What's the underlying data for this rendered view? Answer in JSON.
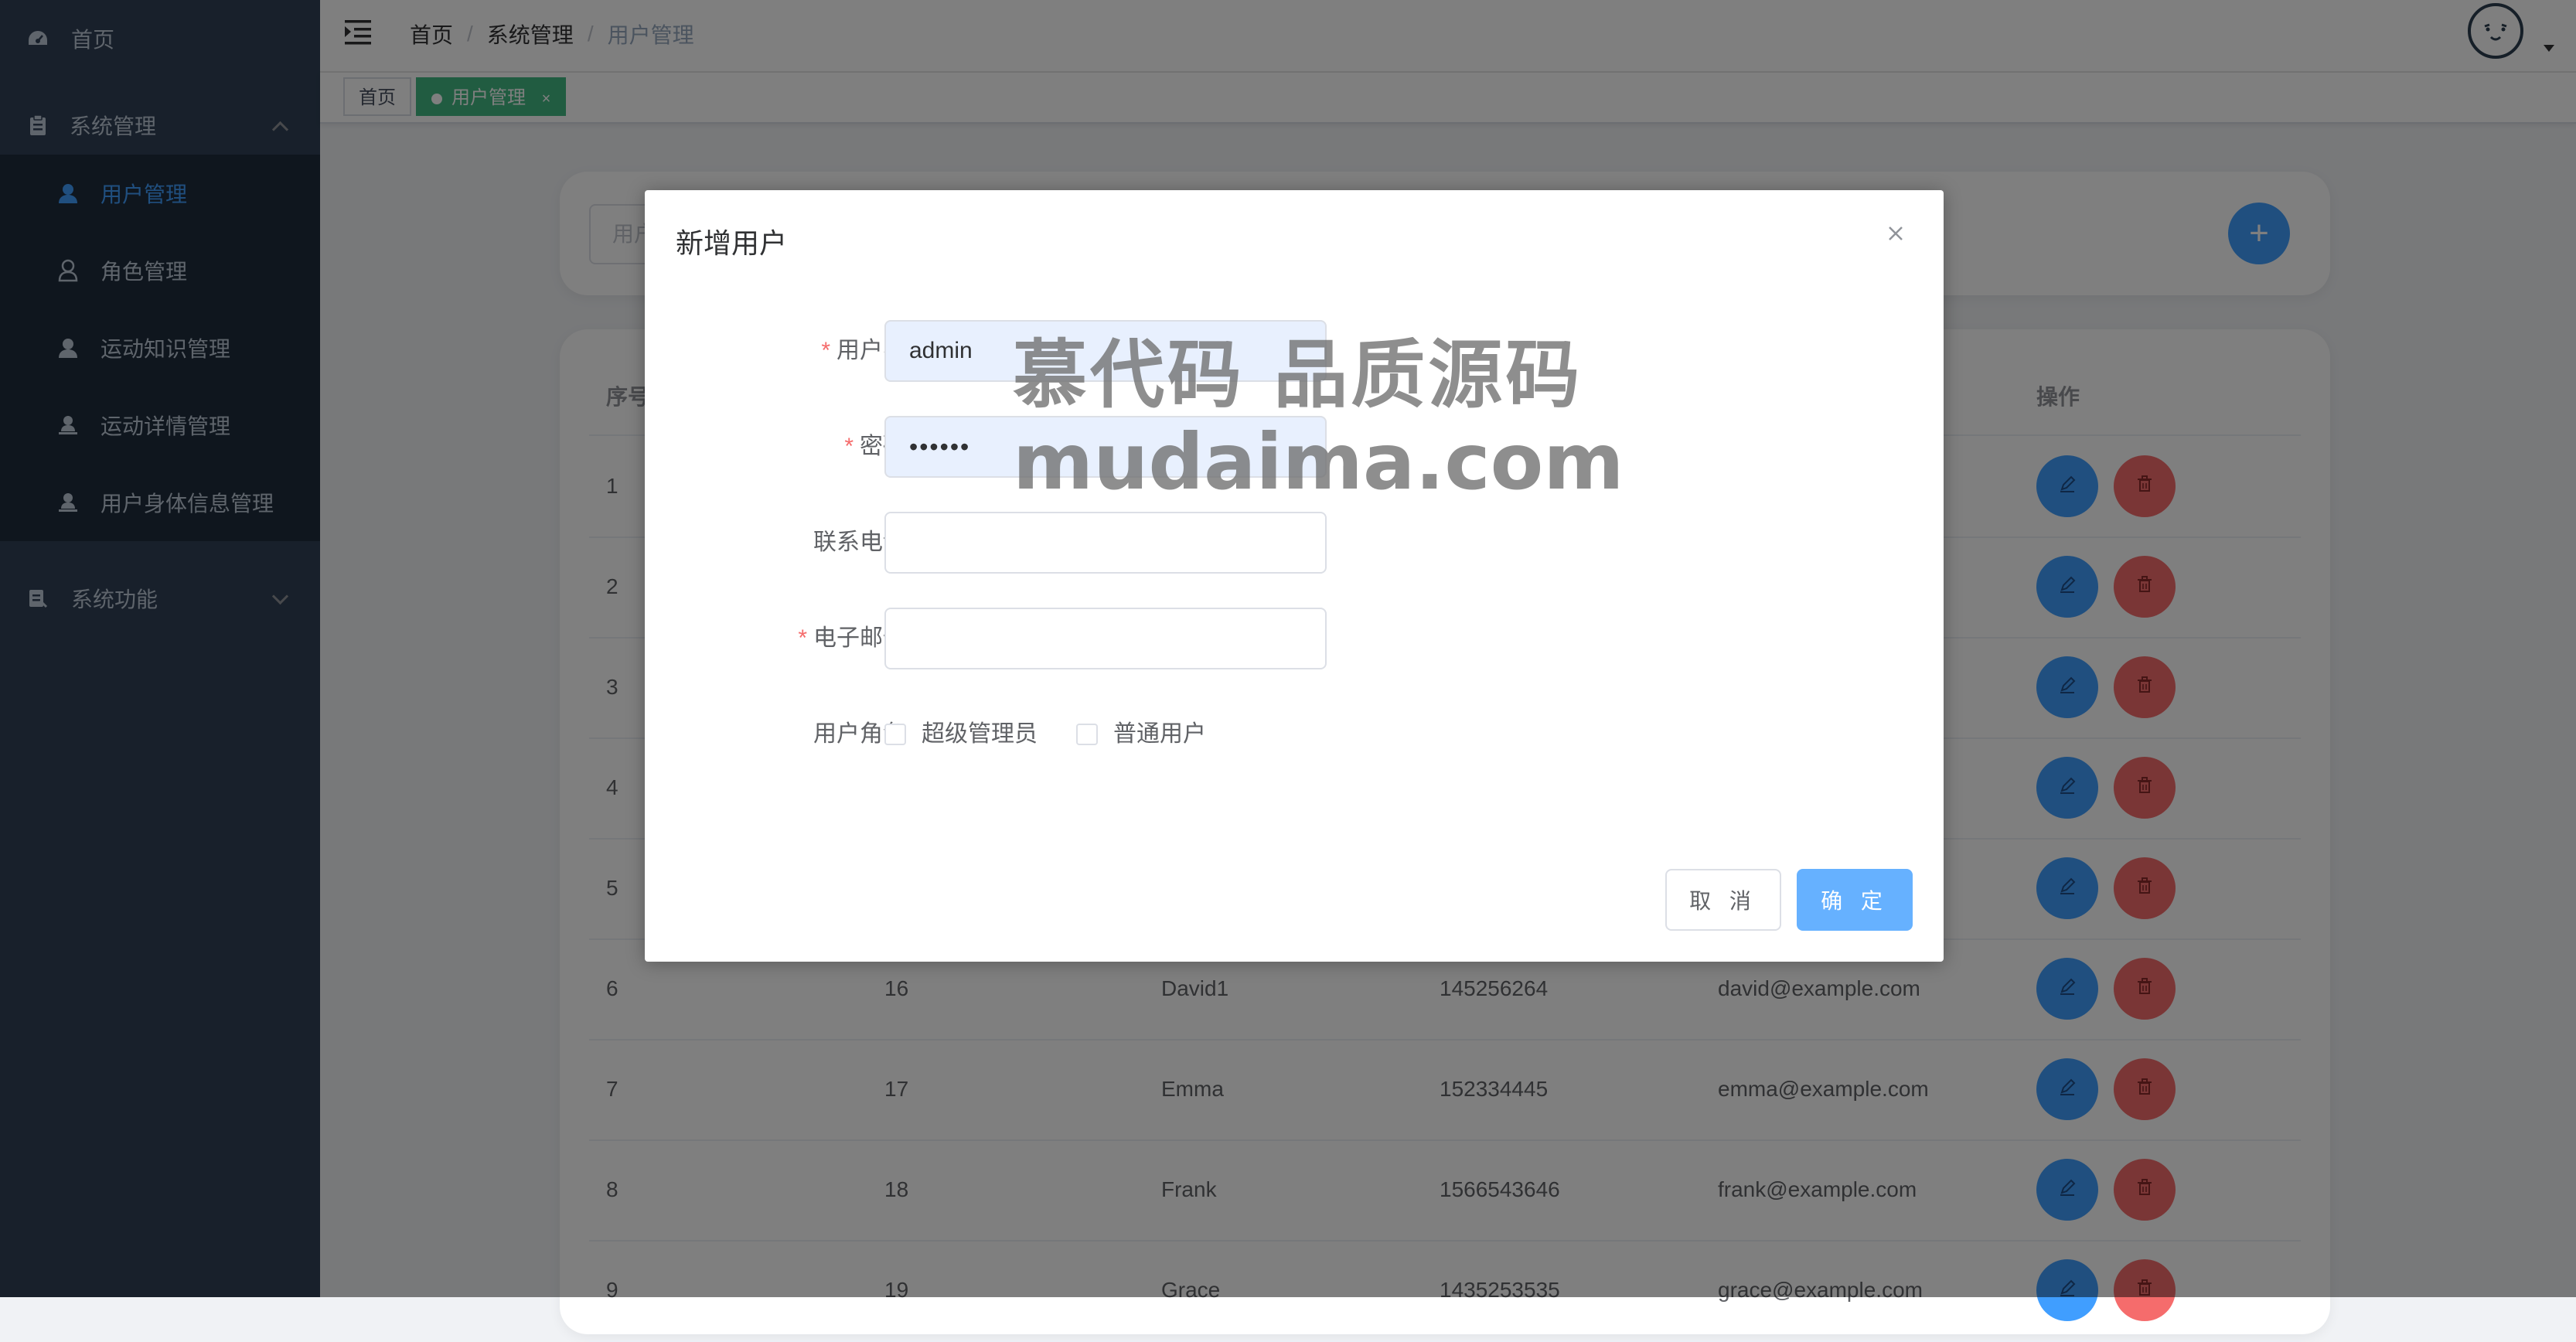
{
  "colors": {
    "sidebar_bg": "#304156",
    "submenu_bg": "#1f2d3d",
    "primary": "#409eff",
    "danger": "#f56c6c",
    "tag_active": "#42b983"
  },
  "sidebar": {
    "items": [
      {
        "label": "首页",
        "icon": "dashboard-icon"
      },
      {
        "label": "系统管理",
        "icon": "clipboard-icon",
        "expanded": true,
        "children": [
          {
            "label": "用户管理",
            "icon": "user-icon",
            "active": true
          },
          {
            "label": "角色管理",
            "icon": "user-outline-icon"
          },
          {
            "label": "运动知识管理",
            "icon": "user-icon"
          },
          {
            "label": "运动详情管理",
            "icon": "user-stand-icon"
          },
          {
            "label": "用户身体信息管理",
            "icon": "user-stand-icon"
          }
        ]
      },
      {
        "label": "系统功能",
        "icon": "document-icon",
        "expanded": false
      }
    ]
  },
  "header": {
    "breadcrumb": [
      "首页",
      "系统管理",
      "用户管理"
    ],
    "breadcrumb_separator": "/"
  },
  "tags": [
    {
      "label": "首页"
    },
    {
      "label": "用户管理",
      "active": true,
      "close": "×"
    }
  ],
  "search": {
    "placeholder": "用户名"
  },
  "add_button": "+",
  "table": {
    "columns": [
      "序号",
      "",
      "",
      "",
      "",
      "操作"
    ],
    "rows": [
      {
        "index": "1",
        "id": "",
        "name": "",
        "phone": "",
        "email": ""
      },
      {
        "index": "2",
        "id": "",
        "name": "",
        "phone": "",
        "email": ""
      },
      {
        "index": "3",
        "id": "",
        "name": "",
        "phone": "",
        "email": ""
      },
      {
        "index": "4",
        "id": "",
        "name": "",
        "phone": "",
        "email": ""
      },
      {
        "index": "5",
        "id": "",
        "name": "",
        "phone": "",
        "email": ""
      },
      {
        "index": "6",
        "id": "16",
        "name": "David1",
        "phone": "145256264",
        "email": "david@example.com"
      },
      {
        "index": "7",
        "id": "17",
        "name": "Emma",
        "phone": "152334445",
        "email": "emma@example.com"
      },
      {
        "index": "8",
        "id": "18",
        "name": "Frank",
        "phone": "1566543646",
        "email": "frank@example.com"
      },
      {
        "index": "9",
        "id": "19",
        "name": "Grace",
        "phone": "1435253535",
        "email": "grace@example.com"
      }
    ]
  },
  "dialog": {
    "title": "新增用户",
    "close": "×",
    "fields": {
      "username": {
        "label": "用户名",
        "required": "*",
        "value": "admin"
      },
      "password": {
        "label": "密码",
        "required": "*",
        "value": "••••••"
      },
      "phone": {
        "label": "联系电话",
        "value": ""
      },
      "email": {
        "label": "电子邮件",
        "required": "*",
        "value": ""
      },
      "role": {
        "label": "用户角色",
        "options": [
          "超级管理员",
          "普通用户"
        ]
      }
    },
    "cancel": "取 消",
    "confirm": "确 定"
  },
  "watermark": {
    "line1": "慕代码 品质源码",
    "line2": "mudaima.com"
  }
}
